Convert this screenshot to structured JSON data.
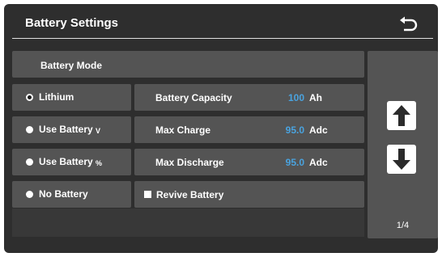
{
  "header": {
    "title": "Battery Settings",
    "back_icon": "back-arrow-icon"
  },
  "mode": {
    "header_label": "Battery Mode",
    "options": [
      {
        "label": "Lithium",
        "suffix": "",
        "selected": true
      },
      {
        "label": "Use Battery",
        "suffix": "V",
        "selected": false
      },
      {
        "label": "Use Battery",
        "suffix": "%",
        "selected": false
      },
      {
        "label": "No Battery",
        "suffix": "",
        "selected": false
      }
    ]
  },
  "settings": {
    "capacity": {
      "label": "Battery Capacity",
      "value": "100",
      "unit": "Ah"
    },
    "max_charge": {
      "label": "Max Charge",
      "value": "95.0",
      "unit": "Adc"
    },
    "max_discharge": {
      "label": "Max Discharge",
      "value": "95.0",
      "unit": "Adc"
    },
    "revive": {
      "label": "Revive Battery",
      "checked": false
    }
  },
  "nav": {
    "up_icon": "arrow-up-icon",
    "down_icon": "arrow-down-icon",
    "page": "1/4"
  },
  "colors": {
    "value_blue": "#4aa3df",
    "panel": "#545454",
    "background": "#2e2e2e"
  }
}
